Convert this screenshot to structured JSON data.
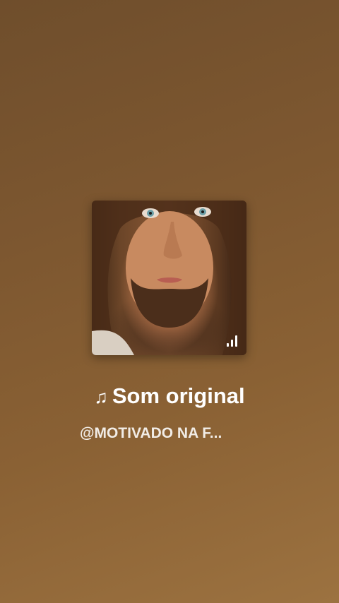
{
  "sound": {
    "note_icon": "music-note-icon",
    "title": "Som original",
    "author": "@MOTIVADO NA F..."
  },
  "cover": {
    "alt": "Jesus portrait",
    "indicator_icon": "signal-bars-icon"
  }
}
